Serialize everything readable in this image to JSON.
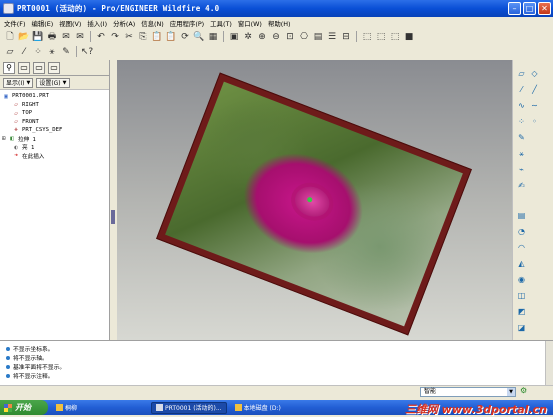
{
  "window": {
    "title": "PRT0001 (活动的) - Pro/ENGINEER Wildfire 4.0"
  },
  "menu": [
    "文件(F)",
    "编辑(E)",
    "视图(V)",
    "插入(I)",
    "分析(A)",
    "信息(N)",
    "应用程序(P)",
    "工具(T)",
    "窗口(W)",
    "帮助(H)"
  ],
  "navigator": {
    "show_dropdown": "显示(I)",
    "settings_dropdown": "设置(G)",
    "tree": [
      {
        "label": "PRT0001.PRT",
        "icon": "part-icon",
        "level": 0
      },
      {
        "label": "RIGHT",
        "icon": "datum-plane-icon",
        "level": 1
      },
      {
        "label": "TOP",
        "icon": "datum-plane-icon",
        "level": 1
      },
      {
        "label": "FRONT",
        "icon": "datum-plane-icon",
        "level": 1
      },
      {
        "label": "PRT_CSYS_DEF",
        "icon": "csys-icon",
        "level": 1
      },
      {
        "label": "拉伸 1",
        "icon": "extrude-icon",
        "level": 1,
        "expandable": true
      },
      {
        "label": "亮 1",
        "icon": "shade-icon",
        "level": 1
      },
      {
        "label": "在此插入",
        "icon": "insert-here-icon",
        "level": 1
      }
    ]
  },
  "messages": [
    "不显示坐标系。",
    "将不显示轴。",
    "基准平面将不显示。",
    "将不显示注释。"
  ],
  "filter": {
    "value": "智能"
  },
  "taskbar": {
    "start_label": "开始",
    "tasks": [
      "桐柳",
      "PRT0001 (活动的)...",
      "本地磁盘 (D:)"
    ],
    "watermark": "三维网 www.3dportal.cn"
  }
}
